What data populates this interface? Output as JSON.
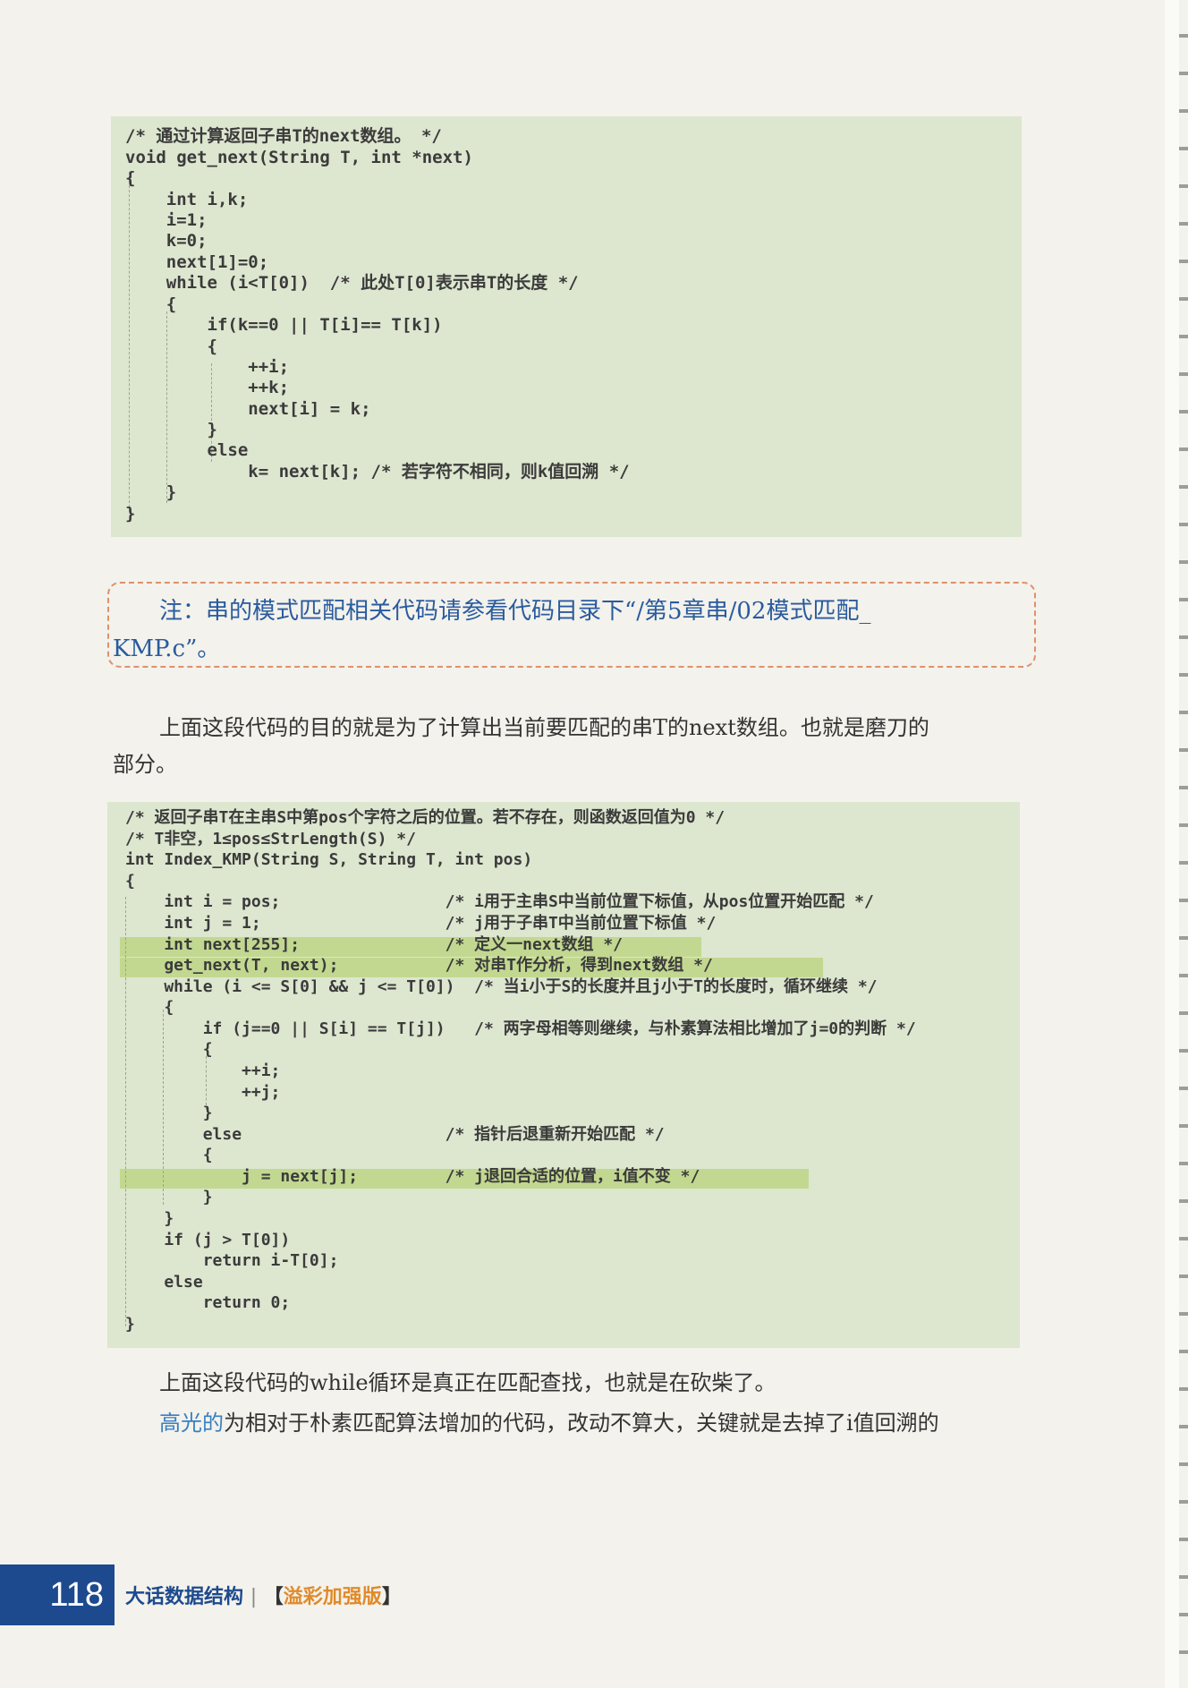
{
  "code_block_1": {
    "lines": [
      "/* 通过计算返回子串T的next数组。 */",
      "void get_next(String T, int *next)",
      "{",
      "    int i,k;",
      "    i=1;",
      "    k=0;",
      "    next[1]=0;",
      "    while (i<T[0])  /* 此处T[0]表示串T的长度 */",
      "    {",
      "        if(k==0 || T[i]== T[k])",
      "        {",
      "            ++i;",
      "            ++k;",
      "            next[i] = k;",
      "        }",
      "        else",
      "            k= next[k]; /* 若字符不相同，则k值回溯 */",
      "    }",
      "}"
    ]
  },
  "note": {
    "line1": "注：串的模式匹配相关代码请参看代码目录下“/第5章串/02模式匹配_",
    "line2": "KMP.c”。"
  },
  "paragraph_1": {
    "line1": "上面这段代码的目的就是为了计算出当前要匹配的串T的next数组。也就是磨刀的",
    "line2": "部分。"
  },
  "code_block_2": {
    "lines": [
      "/* 返回子串T在主串S中第pos个字符之后的位置。若不存在，则函数返回值为0 */",
      "/* T非空，1≤pos≤StrLength(S) */",
      "int Index_KMP(String S, String T, int pos)",
      "{",
      "    int i = pos;                 /* i用于主串S中当前位置下标值，从pos位置开始匹配 */",
      "    int j = 1;                   /* j用于子串T中当前位置下标值 */",
      "    int next[255];               /* 定义一next数组 */",
      "    get_next(T, next);           /* 对串T作分析，得到next数组 */",
      "    while (i <= S[0] && j <= T[0])  /* 当i小于S的长度并且j小于T的长度时，循环继续 */",
      "    {",
      "        if (j==0 || S[i] == T[j])   /* 两字母相等则继续，与朴素算法相比增加了j=0的判断 */",
      "        {",
      "            ++i;",
      "            ++j;",
      "        }",
      "        else                     /* 指针后退重新开始匹配 */",
      "        {",
      "            j = next[j];         /* j退回合适的位置，i值不变 */",
      "        }",
      "    }",
      "    if (j > T[0])",
      "        return i-T[0];",
      "    else",
      "        return 0;",
      "}"
    ]
  },
  "paragraph_2": {
    "line1": "上面这段代码的while循环是真正在匹配查找，也就是在砍柴了。",
    "line2_highlight": "高光的",
    "line2_rest": "为相对于朴素匹配算法增加的代码，改动不算大，关键就是去掉了i值回溯的"
  },
  "footer": {
    "page_number": "118",
    "book_title": "大话数据结构",
    "separator": "|",
    "edition_open": "【",
    "edition": "溢彩加强版",
    "edition_close": "】"
  }
}
